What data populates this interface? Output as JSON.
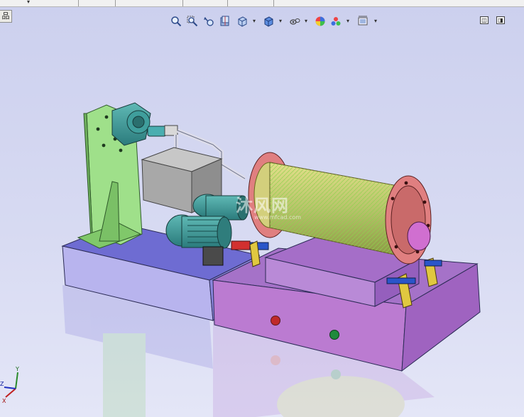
{
  "sidebar_tab": {
    "label": "品"
  },
  "toolbar": {
    "items": [
      {
        "name": "zoom-to-fit-icon"
      },
      {
        "name": "zoom-to-area-icon"
      },
      {
        "name": "previous-view-icon"
      },
      {
        "name": "section-view-icon"
      },
      {
        "name": "view-orientation-icon"
      },
      {
        "name": "display-style-icon"
      },
      {
        "name": "hide-show-items-icon"
      },
      {
        "name": "edit-appearance-icon"
      },
      {
        "name": "apply-scene-icon"
      },
      {
        "name": "view-settings-icon"
      }
    ],
    "dropdown_glyph": "▾"
  },
  "window_controls": {
    "left_label": "◫",
    "right_label": "◨"
  },
  "watermark": {
    "text": "沐风网",
    "sub": "www.mfcad.com"
  },
  "triad": {
    "x_label": "X",
    "y_label": "Y",
    "z_label": "Z"
  },
  "colors": {
    "background_top": "#ccd0ee",
    "background_bottom": "#e4e6f7",
    "left_base": "#6d6cd0",
    "right_base": "#a070c0",
    "bracket": "#8ed07c",
    "tank": "#b9b9b9",
    "motor": "#3e9a9a",
    "drum": "#c2c05e",
    "flange": "#e07b7b"
  }
}
